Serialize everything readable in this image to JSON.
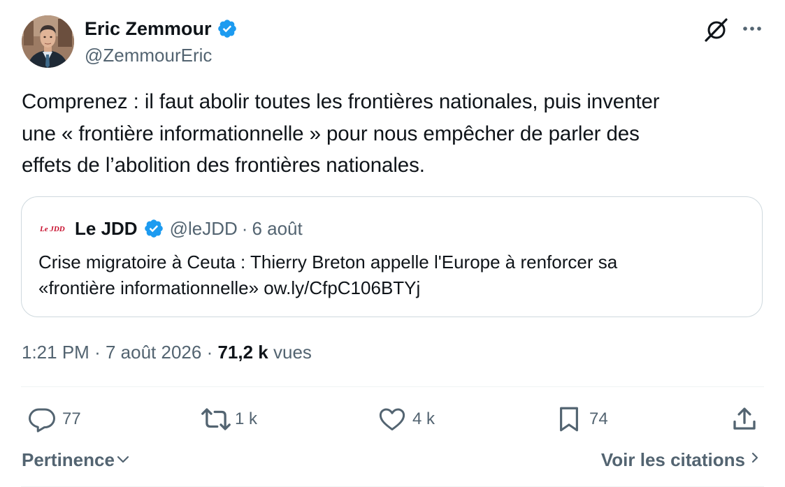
{
  "author": {
    "name": "Eric Zemmour",
    "handle": "@ZemmourEric",
    "verified_color": "#1d9bf0"
  },
  "header_icons": {
    "grok": "grok-icon",
    "more": "more-icon"
  },
  "tweet": {
    "text": "Comprenez : il faut abolir toutes les frontières nationales, puis inventer\nune « frontière informationnelle » pour nous empêcher de parler des\neffets de l’abolition des frontières nationales."
  },
  "quote": {
    "logo_text": "Le JDD",
    "name": "Le JDD",
    "handle": "@leJDD",
    "separator": "·",
    "date": "6 août",
    "text_line1": "Crise migratoire à Ceuta : Thierry Breton appelle l'Europe à renforcer sa",
    "text_line2": "«frontière informationnelle» ow.ly/CfpC106BTYj"
  },
  "meta": {
    "time": "1:21 PM",
    "separator": "·",
    "date": "7 août 2026",
    "views_count": "71,2 k",
    "views_label": "vues"
  },
  "actions": {
    "replies": "77",
    "reposts": "1 k",
    "likes": "4 k",
    "bookmarks": "74"
  },
  "footer": {
    "sort_label": "Pertinence",
    "quotes_label": "Voir les citations"
  },
  "colors": {
    "text": "#0f1419",
    "muted": "#536471",
    "border": "#cfd9de",
    "accent": "#1d9bf0",
    "jdd_red": "#c8102e"
  }
}
